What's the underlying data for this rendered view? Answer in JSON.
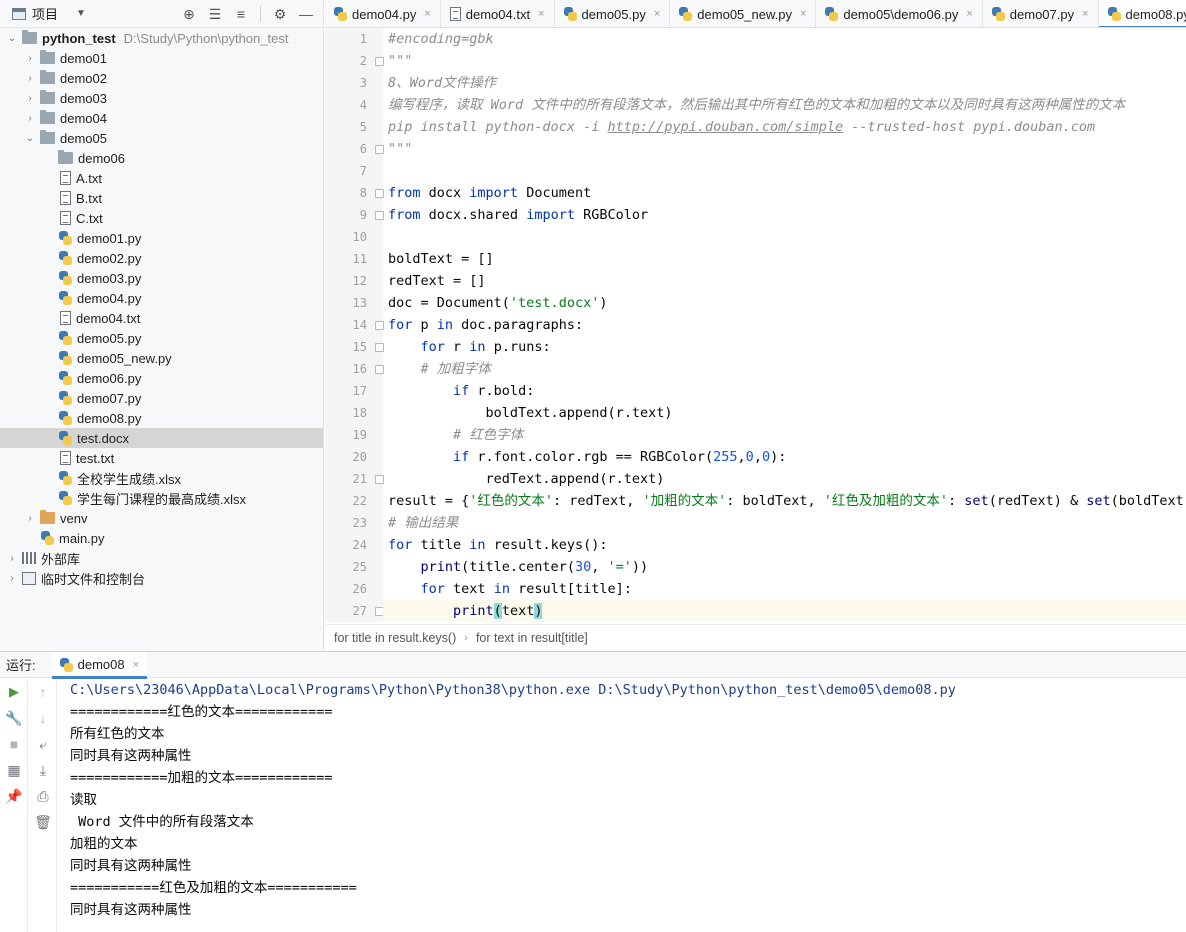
{
  "project": {
    "title": "项目",
    "tree": [
      {
        "label": "python_test",
        "path": "D:\\Study\\Python\\python_test",
        "type": "folder",
        "level": 0,
        "expanded": true,
        "bold": true
      },
      {
        "label": "demo01",
        "type": "folder",
        "level": 1,
        "expanded": false
      },
      {
        "label": "demo02",
        "type": "folder",
        "level": 1,
        "expanded": false
      },
      {
        "label": "demo03",
        "type": "folder",
        "level": 1,
        "expanded": false
      },
      {
        "label": "demo04",
        "type": "folder",
        "level": 1,
        "expanded": false
      },
      {
        "label": "demo05",
        "type": "folder",
        "level": 1,
        "expanded": true
      },
      {
        "label": "demo06",
        "type": "folder",
        "level": 2,
        "expanded": null
      },
      {
        "label": "A.txt",
        "type": "txt",
        "level": 2
      },
      {
        "label": "B.txt",
        "type": "txt",
        "level": 2
      },
      {
        "label": "C.txt",
        "type": "txt",
        "level": 2
      },
      {
        "label": "demo01.py",
        "type": "py",
        "level": 2
      },
      {
        "label": "demo02.py",
        "type": "py",
        "level": 2
      },
      {
        "label": "demo03.py",
        "type": "py",
        "level": 2
      },
      {
        "label": "demo04.py",
        "type": "py",
        "level": 2
      },
      {
        "label": "demo04.txt",
        "type": "txt",
        "level": 2
      },
      {
        "label": "demo05.py",
        "type": "py",
        "level": 2
      },
      {
        "label": "demo05_new.py",
        "type": "py",
        "level": 2
      },
      {
        "label": "demo06.py",
        "type": "py",
        "level": 2
      },
      {
        "label": "demo07.py",
        "type": "py",
        "level": 2
      },
      {
        "label": "demo08.py",
        "type": "py",
        "level": 2
      },
      {
        "label": "test.docx",
        "type": "docx",
        "level": 2,
        "selected": true
      },
      {
        "label": "test.txt",
        "type": "txt",
        "level": 2
      },
      {
        "label": "全校学生成绩.xlsx",
        "type": "xlsx",
        "level": 2
      },
      {
        "label": "学生每门课程的最高成绩.xlsx",
        "type": "xlsx",
        "level": 2
      },
      {
        "label": "venv",
        "type": "folder-orange",
        "level": 1,
        "expanded": false
      },
      {
        "label": "main.py",
        "type": "py",
        "level": 1
      },
      {
        "label": "外部库",
        "type": "lib",
        "level": 0,
        "expanded": false
      },
      {
        "label": "临时文件和控制台",
        "type": "scratch",
        "level": 0,
        "expanded": false
      }
    ]
  },
  "editor": {
    "tabs": [
      {
        "label": "demo04.py",
        "type": "py"
      },
      {
        "label": "demo04.txt",
        "type": "txt"
      },
      {
        "label": "demo05.py",
        "type": "py"
      },
      {
        "label": "demo05_new.py",
        "type": "py"
      },
      {
        "label": "demo05\\demo06.py",
        "type": "py"
      },
      {
        "label": "demo07.py",
        "type": "py"
      },
      {
        "label": "demo08.py",
        "type": "py",
        "active": true
      }
    ],
    "current_line": 27,
    "fold_lines": [
      2,
      6,
      8,
      9,
      14,
      15,
      16,
      21,
      27
    ],
    "code": [
      [
        [
          "c-com",
          "#encoding=gbk"
        ]
      ],
      [
        [
          "c-com",
          "\"\"\""
        ]
      ],
      [
        [
          "c-com",
          "8、Word文件操作"
        ]
      ],
      [
        [
          "c-com",
          "编写程序，读取 Word 文件中的所有段落文本，然后输出其中所有红色的文本和加粗的文本以及同时具有这两种属性的文本"
        ]
      ],
      [
        [
          "c-com",
          "pip install python-docx -i "
        ],
        [
          "c-url",
          "http://pypi.douban.com/simple"
        ],
        [
          "c-com",
          " --trusted-host pypi.douban.com"
        ]
      ],
      [
        [
          "c-com",
          "\"\"\""
        ]
      ],
      [],
      [
        [
          "c-kw",
          "from"
        ],
        [
          "c-plain",
          " docx "
        ],
        [
          "c-kw",
          "import"
        ],
        [
          "c-plain",
          " Document"
        ]
      ],
      [
        [
          "c-kw",
          "from"
        ],
        [
          "c-plain",
          " docx.shared "
        ],
        [
          "c-kw",
          "import"
        ],
        [
          "c-plain",
          " RGBColor"
        ]
      ],
      [],
      [
        [
          "c-plain",
          "boldText = []"
        ]
      ],
      [
        [
          "c-plain",
          "redText = []"
        ]
      ],
      [
        [
          "c-plain",
          "doc = Document("
        ],
        [
          "c-str",
          "'test.docx'"
        ],
        [
          "c-plain",
          ")"
        ]
      ],
      [
        [
          "c-kw",
          "for"
        ],
        [
          "c-plain",
          " p "
        ],
        [
          "c-kw",
          "in"
        ],
        [
          "c-plain",
          " doc.paragraphs:"
        ]
      ],
      [
        [
          "c-plain",
          "    "
        ],
        [
          "c-kw",
          "for"
        ],
        [
          "c-plain",
          " r "
        ],
        [
          "c-kw",
          "in"
        ],
        [
          "c-plain",
          " p.runs:"
        ]
      ],
      [
        [
          "c-plain",
          "    "
        ],
        [
          "c-com",
          "# 加粗字体"
        ]
      ],
      [
        [
          "c-plain",
          "        "
        ],
        [
          "c-kw",
          "if"
        ],
        [
          "c-plain",
          " r.bold:"
        ]
      ],
      [
        [
          "c-plain",
          "            boldText.append(r.text)"
        ]
      ],
      [
        [
          "c-plain",
          "        "
        ],
        [
          "c-com",
          "# 红色字体"
        ]
      ],
      [
        [
          "c-plain",
          "        "
        ],
        [
          "c-kw",
          "if"
        ],
        [
          "c-plain",
          " r.font.color.rgb == RGBColor("
        ],
        [
          "c-num",
          "255"
        ],
        [
          "c-plain",
          ","
        ],
        [
          "c-num",
          "0"
        ],
        [
          "c-plain",
          ","
        ],
        [
          "c-num",
          "0"
        ],
        [
          "c-plain",
          "):"
        ]
      ],
      [
        [
          "c-plain",
          "            redText.append(r.text)"
        ]
      ],
      [
        [
          "c-plain",
          "result = {"
        ],
        [
          "c-str",
          "'红色的文本'"
        ],
        [
          "c-plain",
          ": redText, "
        ],
        [
          "c-str",
          "'加粗的文本'"
        ],
        [
          "c-plain",
          ": boldText, "
        ],
        [
          "c-str",
          "'红色及加粗的文本'"
        ],
        [
          "c-plain",
          ": "
        ],
        [
          "c-built",
          "set"
        ],
        [
          "c-plain",
          "(redText) & "
        ],
        [
          "c-built",
          "set"
        ],
        [
          "c-plain",
          "(boldText)}"
        ]
      ],
      [
        [
          "c-com",
          "# 输出结果"
        ]
      ],
      [
        [
          "c-kw",
          "for"
        ],
        [
          "c-plain",
          " title "
        ],
        [
          "c-kw",
          "in"
        ],
        [
          "c-plain",
          " result.keys():"
        ]
      ],
      [
        [
          "c-plain",
          "    "
        ],
        [
          "c-built",
          "print"
        ],
        [
          "c-plain",
          "(title.center("
        ],
        [
          "c-num",
          "30"
        ],
        [
          "c-plain",
          ", "
        ],
        [
          "c-str",
          "'='"
        ],
        [
          "c-plain",
          "))"
        ]
      ],
      [
        [
          "c-plain",
          "    "
        ],
        [
          "c-kw",
          "for"
        ],
        [
          "c-plain",
          " text "
        ],
        [
          "c-kw",
          "in"
        ],
        [
          "c-plain",
          " result[title]:"
        ]
      ],
      [
        [
          "c-plain",
          "        "
        ],
        [
          "c-built",
          "print"
        ],
        [
          "c-hl",
          "("
        ],
        [
          "c-plain",
          "text"
        ],
        [
          "c-hl",
          ")"
        ]
      ]
    ],
    "breadcrumb": [
      "for title in result.keys()",
      "for text in result[title]"
    ]
  },
  "run": {
    "label": "运行:",
    "tab_label": "demo08",
    "tab_close": "×",
    "output": [
      "C:\\Users\\23046\\AppData\\Local\\Programs\\Python\\Python38\\python.exe D:\\Study\\Python\\python_test\\demo05\\demo08.py",
      "============红色的文本============",
      "所有红色的文本",
      "同时具有这两种属性",
      "============加粗的文本============",
      "读取",
      " Word 文件中的所有段落文本",
      "加粗的文本",
      "同时具有这两种属性",
      "===========红色及加粗的文本===========",
      "同时具有这两种属性"
    ]
  },
  "icons": {
    "tab_close": "×"
  }
}
